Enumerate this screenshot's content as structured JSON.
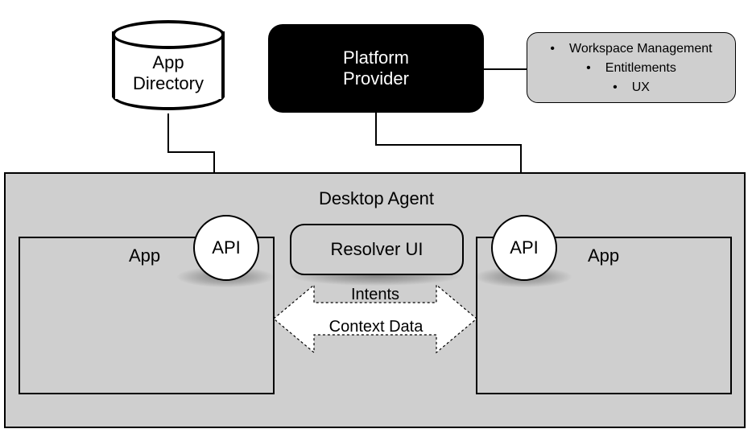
{
  "appDirectory": {
    "label": "App\nDirectory"
  },
  "platformProvider": {
    "label": "Platform\nProvider"
  },
  "features": {
    "items": [
      "Workspace Management",
      "Entitlements",
      "UX"
    ]
  },
  "desktopAgent": {
    "title": "Desktop Agent",
    "resolver": "Resolver UI",
    "api": "API",
    "appLabel": "App",
    "flow": {
      "intents": "Intents",
      "contextData": "Context Data"
    }
  }
}
